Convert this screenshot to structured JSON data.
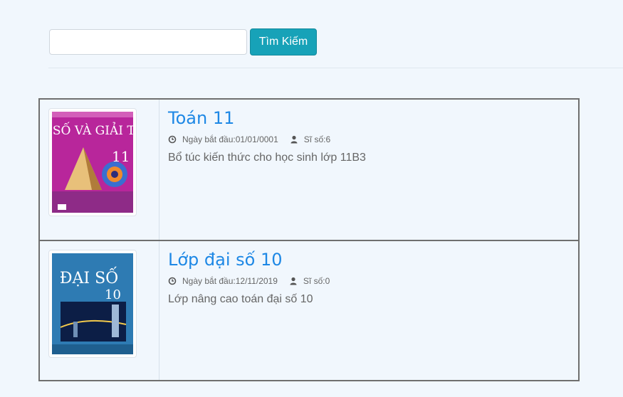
{
  "search": {
    "placeholder": "",
    "value": "",
    "button_label": "Tìm Kiếm"
  },
  "meta_labels": {
    "start_date": "Ngày bắt đầu: ",
    "count": "Sĩ số: "
  },
  "courses": [
    {
      "title": "Toán 11",
      "start_date": "01/01/0001",
      "count": "6",
      "description": "Bổ túc kiến thức cho học sinh lớp 11B3",
      "cover": {
        "heading": "ĐẠI SỐ VÀ GIẢI TÍCH",
        "grade": "11",
        "color": "#b8269b"
      }
    },
    {
      "title": "Lớp đại số 10",
      "start_date": "12/11/2019",
      "count": "0",
      "description": "Lớp nâng cao toán đại số 10",
      "cover": {
        "heading": "ĐẠI SỐ",
        "grade": "10",
        "color": "#2e7bb3"
      }
    }
  ],
  "colors": {
    "accent": "#17a2b8",
    "title": "#1e88e5",
    "background": "#f1f7fd"
  }
}
